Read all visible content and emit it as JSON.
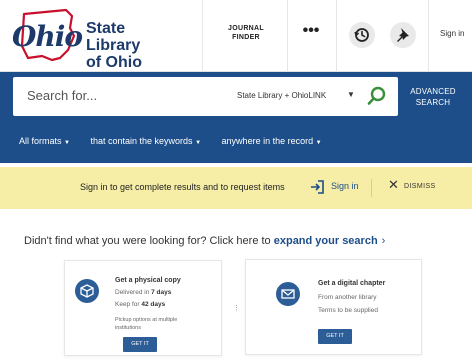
{
  "header": {
    "logo_script": "Ohio",
    "title_line1": "State Library",
    "title_line2": "of Ohio",
    "journal_finder": "JOURNAL FINDER",
    "more_label": "•••",
    "history_icon": "history-icon",
    "pin_icon": "pin-icon",
    "sign_in": "Sign in"
  },
  "search": {
    "placeholder": "Search for...",
    "scope": "State Library + OhioLINK",
    "advanced": "ADVANCED SEARCH"
  },
  "filters": {
    "format": "All formats",
    "keywords": "that contain the keywords",
    "record": "anywhere in the record"
  },
  "notice": {
    "text": "Sign in to get complete results and to request items",
    "sign_in": "Sign in",
    "dismiss": "DISMISS"
  },
  "expand": {
    "prefix": "Didn't find what you were looking for? Click here to ",
    "link": "expand your search",
    "arrow": "›"
  },
  "cards": [
    {
      "title": "Get a physical copy",
      "line1_pre": "Delivered in ",
      "line1_bold": "7 days",
      "line2_pre": "Keep for ",
      "line2_bold": "42 days",
      "line3": "Pickup options at multiple institutions",
      "button": "GET IT"
    },
    {
      "title": "Get a digital chapter",
      "line1": "From another library",
      "line2": "Terms to be supplied",
      "button": "GET IT"
    }
  ],
  "colors": {
    "brand_blue": "#1d4e89",
    "logo_red": "#c8102e",
    "notice_yellow": "#f6eea7",
    "go_green": "#3a8f3a"
  }
}
